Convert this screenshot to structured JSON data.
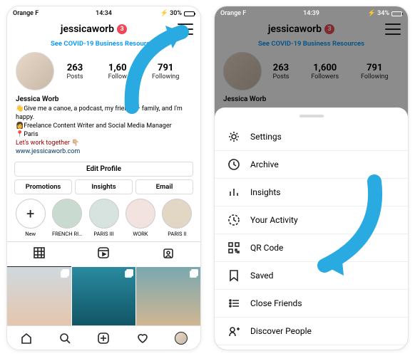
{
  "status_left": {
    "carrier": "Orange F",
    "time": "14:34",
    "battery_pct": "30%",
    "battery_fill_css": "width:30%"
  },
  "status_right": {
    "carrier": "Orange F",
    "time": "14:39",
    "battery_pct": "34%",
    "battery_fill_css": "width:34%"
  },
  "profile": {
    "username": "jessicaworb",
    "notif_count": "3",
    "covid_link": "See COVID-19 Business Resources",
    "stats": {
      "posts_n": "263",
      "posts_l": "Posts",
      "followers_n": "1,600",
      "followers_l": "Followers",
      "followers_n_clipped": "1,60",
      "followers_l_clipped": "Follow",
      "following_n": "791",
      "following_l": "Following"
    },
    "bio": {
      "name": "Jessica Worb",
      "line1": "👋Give me a canoe, a podcast, my friends + family, and I'm happy.",
      "line2": "👩Freelance Content Writer and Social Media Manager",
      "line3": "📍Paris",
      "line4": "Let's work together 👇🏼",
      "url": "www.jessicaworb.com"
    },
    "edit_label": "Edit Profile",
    "btns": {
      "promotions": "Promotions",
      "insights": "Insights",
      "email": "Email"
    },
    "highlights": [
      {
        "label": "New",
        "color": "#fff",
        "is_new": true
      },
      {
        "label": "FRENCH RI…",
        "color": "#c9dbd1"
      },
      {
        "label": "PARIS III",
        "color": "#d6e3de"
      },
      {
        "label": "WORK",
        "color": "#f3e3e0"
      },
      {
        "label": "PARIS II",
        "color": "#e1d7c4"
      }
    ],
    "grid_colors": [
      "linear-gradient(#cfd9e0,#e8c4a8)",
      "linear-gradient(#2a8aa0,#0e5060)",
      "linear-gradient(#7aa8b0,#d8b890)"
    ]
  },
  "menu": {
    "items": [
      {
        "key": "settings",
        "label": "Settings"
      },
      {
        "key": "archive",
        "label": "Archive"
      },
      {
        "key": "insights",
        "label": "Insights"
      },
      {
        "key": "activity",
        "label": "Your Activity"
      },
      {
        "key": "qrcode",
        "label": "QR Code"
      },
      {
        "key": "saved",
        "label": "Saved"
      },
      {
        "key": "closefriends",
        "label": "Close Friends"
      },
      {
        "key": "discover",
        "label": "Discover People"
      }
    ]
  }
}
